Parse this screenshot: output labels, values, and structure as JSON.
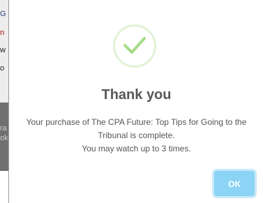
{
  "background_fragments": [
    {
      "text": "G"
    },
    {
      "text": "n"
    },
    {
      "text": "w"
    },
    {
      "text": "o"
    },
    {
      "text": "ra"
    },
    {
      "text": "ok"
    }
  ],
  "dialog": {
    "title": "Thank you",
    "message_lines": [
      "Your purchase of The CPA Future: Top Tips for Going to the",
      "Tribunal is complete.",
      "You may watch up to 3 times."
    ],
    "ok_label": "OK",
    "icon": "checkmark-icon",
    "colors": {
      "check": "#a5dc86",
      "check_ring": "#e1f2d5",
      "ok_button": "#8cd4f5",
      "title_text": "#575757",
      "body_text": "#555555"
    }
  }
}
